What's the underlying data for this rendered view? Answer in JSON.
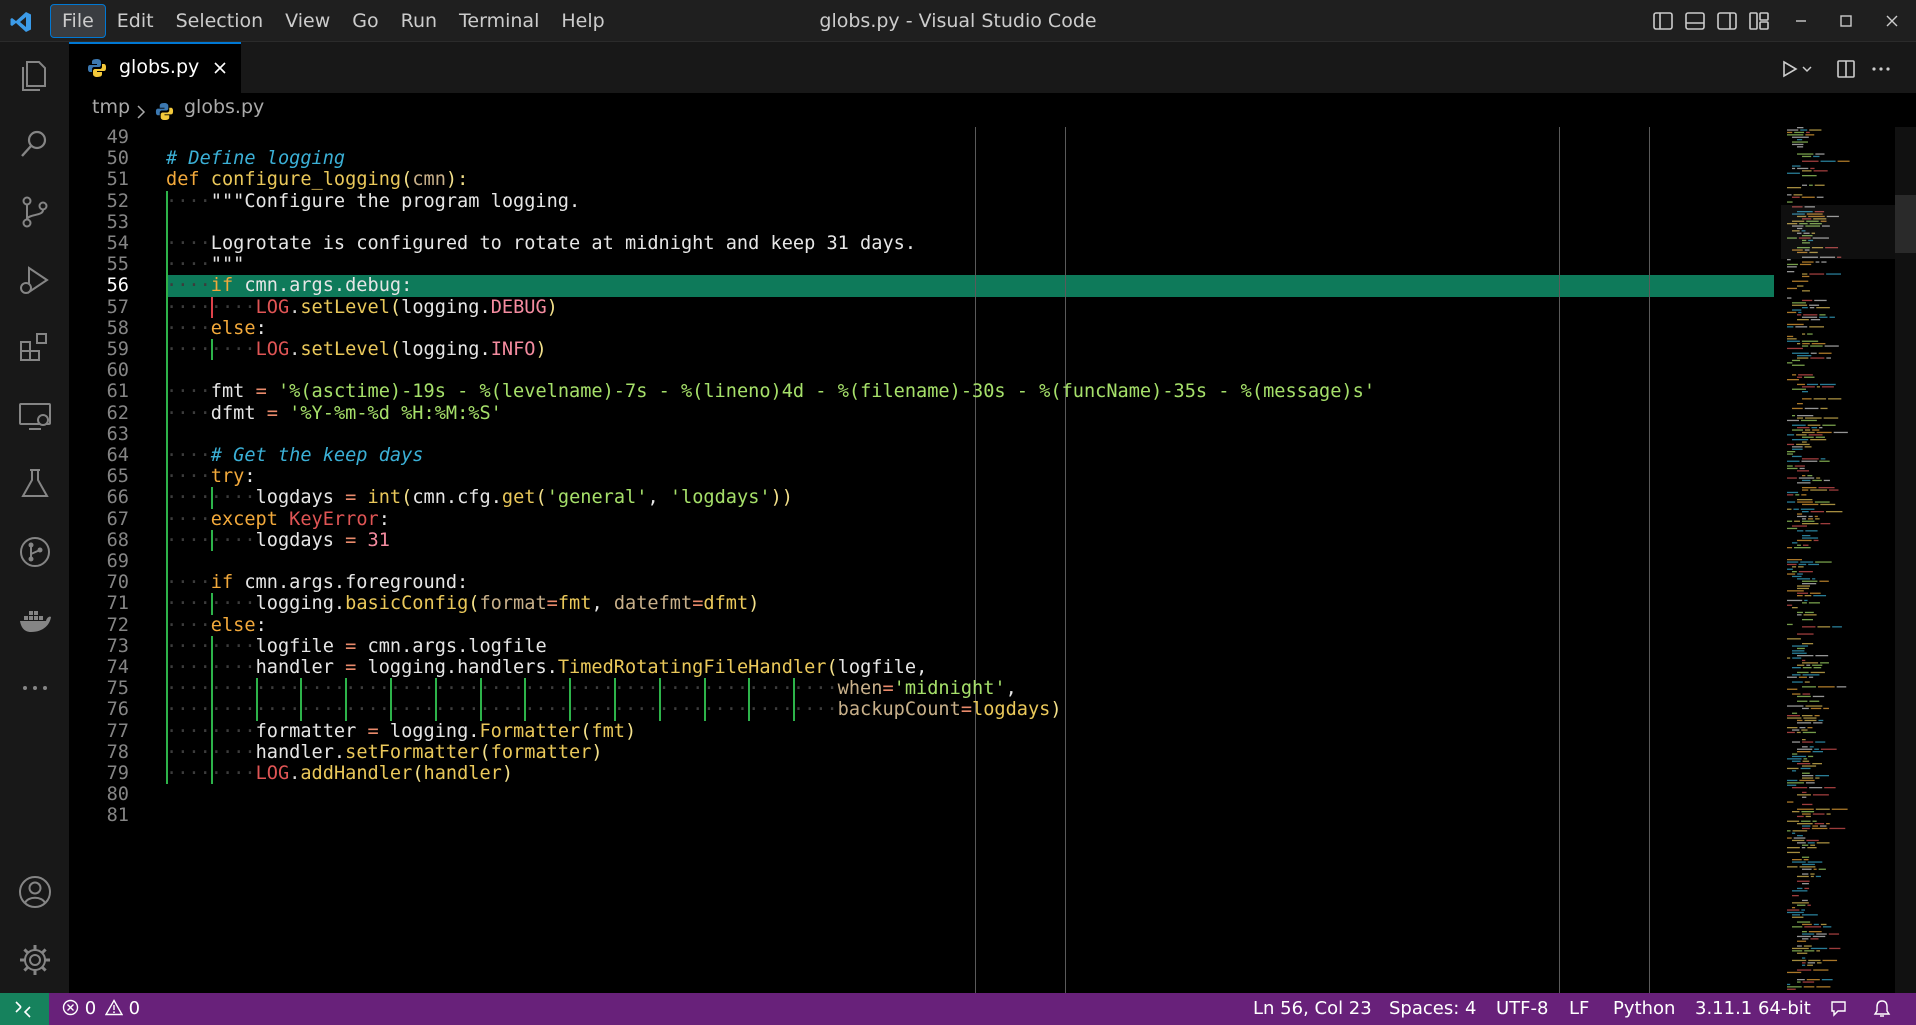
{
  "window": {
    "title": "globs.py - Visual Studio Code"
  },
  "menu": [
    "File",
    "Edit",
    "Selection",
    "View",
    "Go",
    "Run",
    "Terminal",
    "Help"
  ],
  "tab": {
    "label": "globs.py",
    "icon": "python-icon"
  },
  "breadcrumb": {
    "folder": "tmp",
    "file": "globs.py"
  },
  "editor": {
    "current_line": 56,
    "lines": [
      {
        "n": 49,
        "tokens": []
      },
      {
        "n": 50,
        "tokens": [
          [
            "cm",
            "# Define logging"
          ]
        ]
      },
      {
        "n": 51,
        "tokens": [
          [
            "kw",
            "def"
          ],
          [
            "id",
            " "
          ],
          [
            "fn",
            "configure_logging"
          ],
          [
            "par",
            "("
          ],
          [
            "argk",
            "cmn"
          ],
          [
            "par",
            "):"
          ]
        ]
      },
      {
        "n": 52,
        "tokens": [
          [
            "ws",
            "····"
          ],
          [
            "id",
            "\"\"\"Configure the program logging."
          ]
        ]
      },
      {
        "n": 53,
        "tokens": []
      },
      {
        "n": 54,
        "tokens": [
          [
            "ws",
            "····"
          ],
          [
            "id",
            "Logrotate is configured to rotate at midnight and keep 31 days."
          ]
        ]
      },
      {
        "n": 55,
        "tokens": [
          [
            "ws",
            "····"
          ],
          [
            "id",
            "\"\"\""
          ]
        ]
      },
      {
        "n": 56,
        "tokens": [
          [
            "ws",
            "····"
          ],
          [
            "kw",
            "if"
          ],
          [
            "id",
            " cmn.args.debug:"
          ]
        ]
      },
      {
        "n": 57,
        "tokens": [
          [
            "ws",
            "········"
          ],
          [
            "cls",
            "LOG"
          ],
          [
            "pu",
            "."
          ],
          [
            "fn",
            "setLevel"
          ],
          [
            "par",
            "("
          ],
          [
            "id",
            "logging."
          ],
          [
            "nu",
            "DEBUG"
          ],
          [
            "par",
            ")"
          ]
        ]
      },
      {
        "n": 58,
        "tokens": [
          [
            "ws",
            "····"
          ],
          [
            "kw",
            "else"
          ],
          [
            "id",
            ":"
          ]
        ]
      },
      {
        "n": 59,
        "tokens": [
          [
            "ws",
            "········"
          ],
          [
            "cls",
            "LOG"
          ],
          [
            "pu",
            "."
          ],
          [
            "fn",
            "setLevel"
          ],
          [
            "par",
            "("
          ],
          [
            "id",
            "logging."
          ],
          [
            "nu",
            "INFO"
          ],
          [
            "par",
            ")"
          ]
        ]
      },
      {
        "n": 60,
        "tokens": []
      },
      {
        "n": 61,
        "tokens": [
          [
            "ws",
            "····"
          ],
          [
            "id",
            "fmt "
          ],
          [
            "op",
            "="
          ],
          [
            "id",
            " "
          ],
          [
            "str",
            "'%(asctime)-19s - %(levelname)-7s - %(lineno)4d - %(filename)-30s - %(funcName)-35s - %(message)s'"
          ]
        ]
      },
      {
        "n": 62,
        "tokens": [
          [
            "ws",
            "····"
          ],
          [
            "id",
            "dfmt "
          ],
          [
            "op",
            "="
          ],
          [
            "id",
            " "
          ],
          [
            "str",
            "'%Y-%m-%d %H:%M:%S'"
          ]
        ]
      },
      {
        "n": 63,
        "tokens": []
      },
      {
        "n": 64,
        "tokens": [
          [
            "ws",
            "····"
          ],
          [
            "cm",
            "# Get the keep days"
          ]
        ]
      },
      {
        "n": 65,
        "tokens": [
          [
            "ws",
            "····"
          ],
          [
            "kw",
            "try"
          ],
          [
            "id",
            ":"
          ]
        ]
      },
      {
        "n": 66,
        "tokens": [
          [
            "ws",
            "········"
          ],
          [
            "id",
            "logdays "
          ],
          [
            "op",
            "="
          ],
          [
            "id",
            " "
          ],
          [
            "fn",
            "int"
          ],
          [
            "par",
            "("
          ],
          [
            "id",
            "cmn.cfg."
          ],
          [
            "fn",
            "get"
          ],
          [
            "par",
            "("
          ],
          [
            "str",
            "'general'"
          ],
          [
            "id",
            ", "
          ],
          [
            "str",
            "'logdays'"
          ],
          [
            "par",
            "))"
          ]
        ]
      },
      {
        "n": 67,
        "tokens": [
          [
            "ws",
            "····"
          ],
          [
            "kw",
            "except"
          ],
          [
            "id",
            " "
          ],
          [
            "kw2",
            "KeyError"
          ],
          [
            "id",
            ":"
          ]
        ]
      },
      {
        "n": 68,
        "tokens": [
          [
            "ws",
            "········"
          ],
          [
            "id",
            "logdays "
          ],
          [
            "op",
            "="
          ],
          [
            "id",
            " "
          ],
          [
            "nu",
            "31"
          ]
        ]
      },
      {
        "n": 69,
        "tokens": []
      },
      {
        "n": 70,
        "tokens": [
          [
            "ws",
            "····"
          ],
          [
            "kw",
            "if"
          ],
          [
            "id",
            " cmn.args.foreground:"
          ]
        ]
      },
      {
        "n": 71,
        "tokens": [
          [
            "ws",
            "········"
          ],
          [
            "id",
            "logging."
          ],
          [
            "fn",
            "basicConfig"
          ],
          [
            "par",
            "("
          ],
          [
            "argk",
            "format"
          ],
          [
            "op",
            "="
          ],
          [
            "fn",
            "fmt"
          ],
          [
            "id",
            ", "
          ],
          [
            "argk",
            "datefmt"
          ],
          [
            "op",
            "="
          ],
          [
            "fn",
            "dfmt"
          ],
          [
            "par",
            ")"
          ]
        ]
      },
      {
        "n": 72,
        "tokens": [
          [
            "ws",
            "····"
          ],
          [
            "kw",
            "else"
          ],
          [
            "id",
            ":"
          ]
        ]
      },
      {
        "n": 73,
        "tokens": [
          [
            "ws",
            "········"
          ],
          [
            "id",
            "logfile "
          ],
          [
            "op",
            "="
          ],
          [
            "id",
            " cmn.args.logfile"
          ]
        ]
      },
      {
        "n": 74,
        "tokens": [
          [
            "ws",
            "········"
          ],
          [
            "id",
            "handler "
          ],
          [
            "op",
            "="
          ],
          [
            "id",
            " logging.handlers."
          ],
          [
            "fn",
            "TimedRotatingFileHandler"
          ],
          [
            "par",
            "("
          ],
          [
            "id",
            "logfile,"
          ]
        ]
      },
      {
        "n": 75,
        "tokens": [
          [
            "ws",
            "····························································"
          ],
          [
            "argk",
            "when"
          ],
          [
            "op",
            "="
          ],
          [
            "str",
            "'midnight'"
          ],
          [
            "id",
            ","
          ]
        ]
      },
      {
        "n": 76,
        "tokens": [
          [
            "ws",
            "····························································"
          ],
          [
            "argk",
            "backupCount"
          ],
          [
            "op",
            "="
          ],
          [
            "fn",
            "logdays"
          ],
          [
            "par",
            ")"
          ]
        ]
      },
      {
        "n": 77,
        "tokens": [
          [
            "ws",
            "········"
          ],
          [
            "id",
            "formatter "
          ],
          [
            "op",
            "="
          ],
          [
            "id",
            " logging."
          ],
          [
            "fn",
            "Formatter"
          ],
          [
            "par",
            "("
          ],
          [
            "fn",
            "fmt"
          ],
          [
            "par",
            ")"
          ]
        ]
      },
      {
        "n": 78,
        "tokens": [
          [
            "ws",
            "········"
          ],
          [
            "id",
            "handler."
          ],
          [
            "fn",
            "setFormatter"
          ],
          [
            "par",
            "("
          ],
          [
            "fn",
            "formatter"
          ],
          [
            "par",
            ")"
          ]
        ]
      },
      {
        "n": 79,
        "tokens": [
          [
            "ws",
            "········"
          ],
          [
            "cls",
            "LOG"
          ],
          [
            "pu",
            "."
          ],
          [
            "fn",
            "addHandler"
          ],
          [
            "par",
            "("
          ],
          [
            "fn",
            "handler"
          ],
          [
            "par",
            ")"
          ]
        ]
      },
      {
        "n": 80,
        "tokens": []
      },
      {
        "n": 81,
        "tokens": []
      }
    ]
  },
  "status": {
    "errors": "0",
    "warnings": "0",
    "cursor": "Ln 56, Col 23",
    "spaces": "Spaces: 4",
    "encoding": "UTF-8",
    "eol": "LF",
    "language": "Python",
    "interpreter": "3.11.1 64-bit"
  },
  "colors": {
    "accent": "#0078d4",
    "statusbar": "#68217a",
    "remote": "#16825d",
    "current_line": "#0e7a5a"
  }
}
